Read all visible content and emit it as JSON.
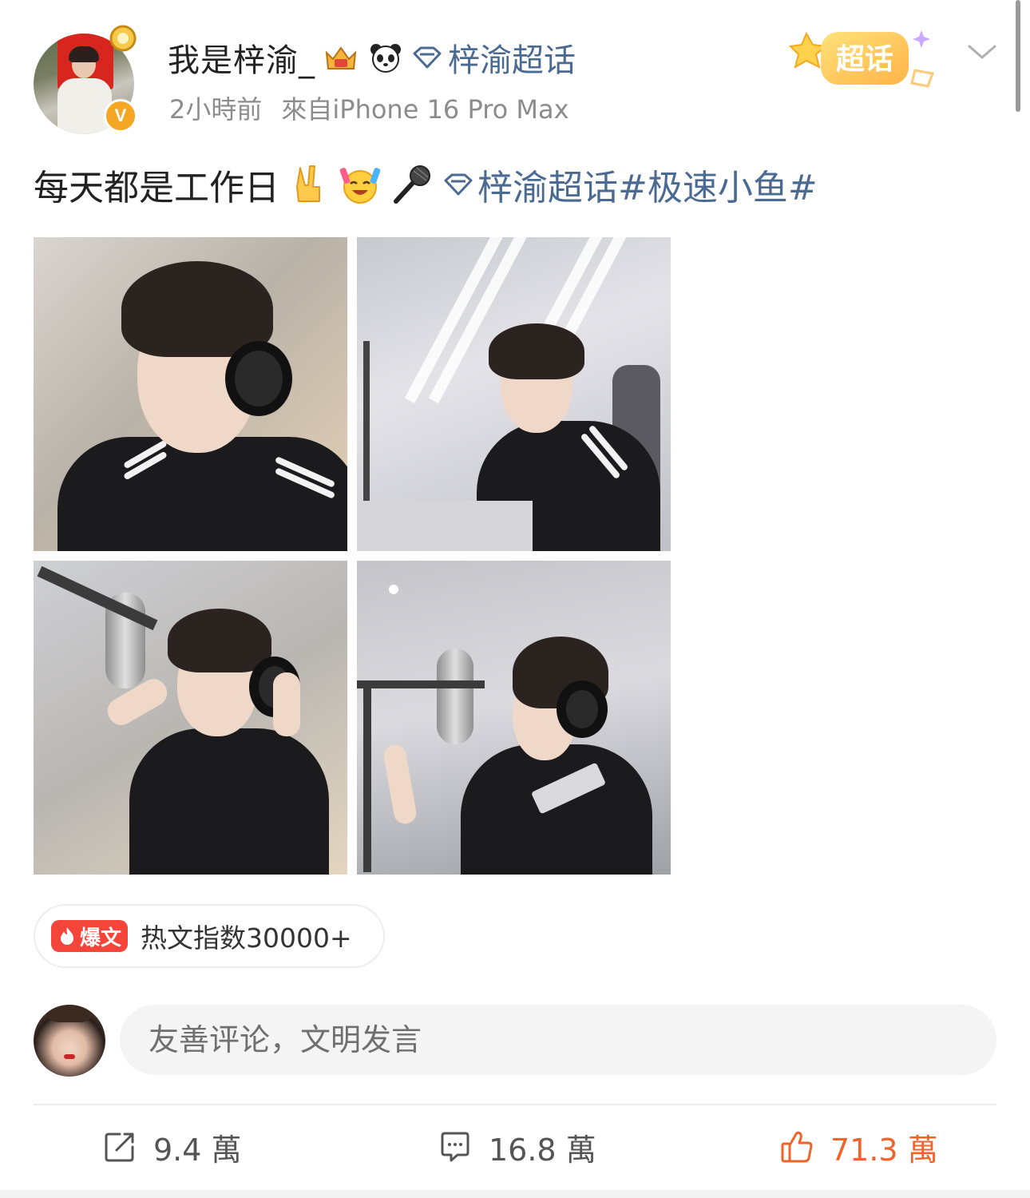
{
  "post": {
    "author": {
      "name": "我是梓渝_",
      "verified": true
    },
    "supertopic_label": "梓渝超话",
    "time": "2小時前",
    "source": "來自iPhone 16 Pro Max",
    "badge_label": "超话",
    "content": {
      "text": "每天都是工作日",
      "emojis": [
        "victory-hand-emoji",
        "party-face-emoji",
        "microphone-emoji"
      ],
      "topic_label": "梓渝超话",
      "hashtag": "#极速小鱼#"
    },
    "images": [
      {
        "alt": "photo-1"
      },
      {
        "alt": "photo-2"
      },
      {
        "alt": "photo-3"
      },
      {
        "alt": "photo-4"
      }
    ],
    "hot": {
      "tag": "爆文",
      "text": "热文指数30000+"
    }
  },
  "comment_box": {
    "placeholder": "友善评论，文明发言"
  },
  "actions": {
    "repost": "9.4 萬",
    "comment": "16.8 萬",
    "like": "71.3 萬"
  },
  "colors": {
    "link": "#4b6a92",
    "like": "#f16329",
    "hot": "#f4453b",
    "verified": "#f5a623"
  }
}
